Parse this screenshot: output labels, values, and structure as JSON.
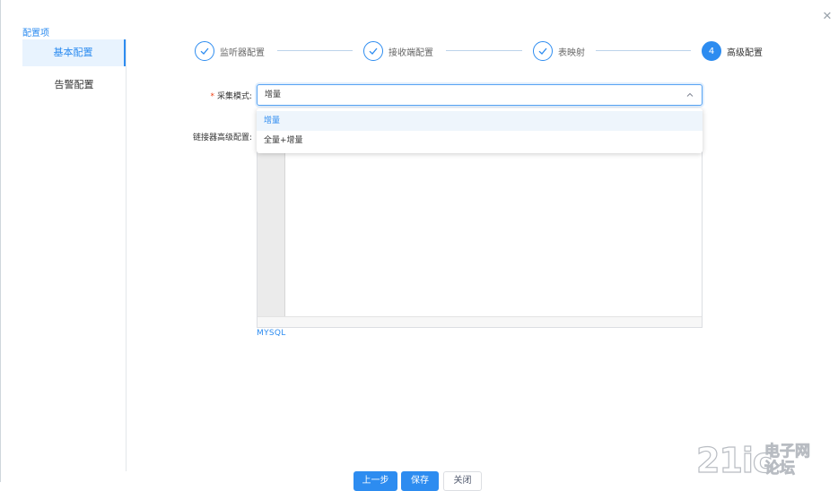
{
  "dialog": {
    "close_icon": "close-icon"
  },
  "sidebar": {
    "title": "配置项",
    "items": [
      {
        "label": "基本配置",
        "active": true
      },
      {
        "label": "告警配置",
        "active": false
      }
    ]
  },
  "steps": [
    {
      "label": "监听器配置",
      "status": "finished",
      "icon": "check-icon"
    },
    {
      "label": "接收端配置",
      "status": "finished",
      "icon": "check-icon"
    },
    {
      "label": "表映射",
      "status": "finished",
      "icon": "check-icon"
    },
    {
      "label": "高级配置",
      "status": "current",
      "number": "4"
    }
  ],
  "form": {
    "collect_mode": {
      "label": "采集模式:",
      "required_mark": "*",
      "value": "增量",
      "options": [
        "增量",
        "全量+增量"
      ],
      "selected_index": 0
    },
    "connector_advanced": {
      "label": "链接器高级配置:",
      "editor_mode_label": "MYSQL"
    }
  },
  "footer": {
    "prev_label": "上一步",
    "save_label": "保存",
    "close_label": "关闭"
  },
  "watermark": {
    "numeral": "21ic",
    "line1": "电子网",
    "line2": "论坛"
  },
  "colors": {
    "accent": "#2d8cf0",
    "required": "#ed4014",
    "option_hover": "#eef5fc"
  }
}
